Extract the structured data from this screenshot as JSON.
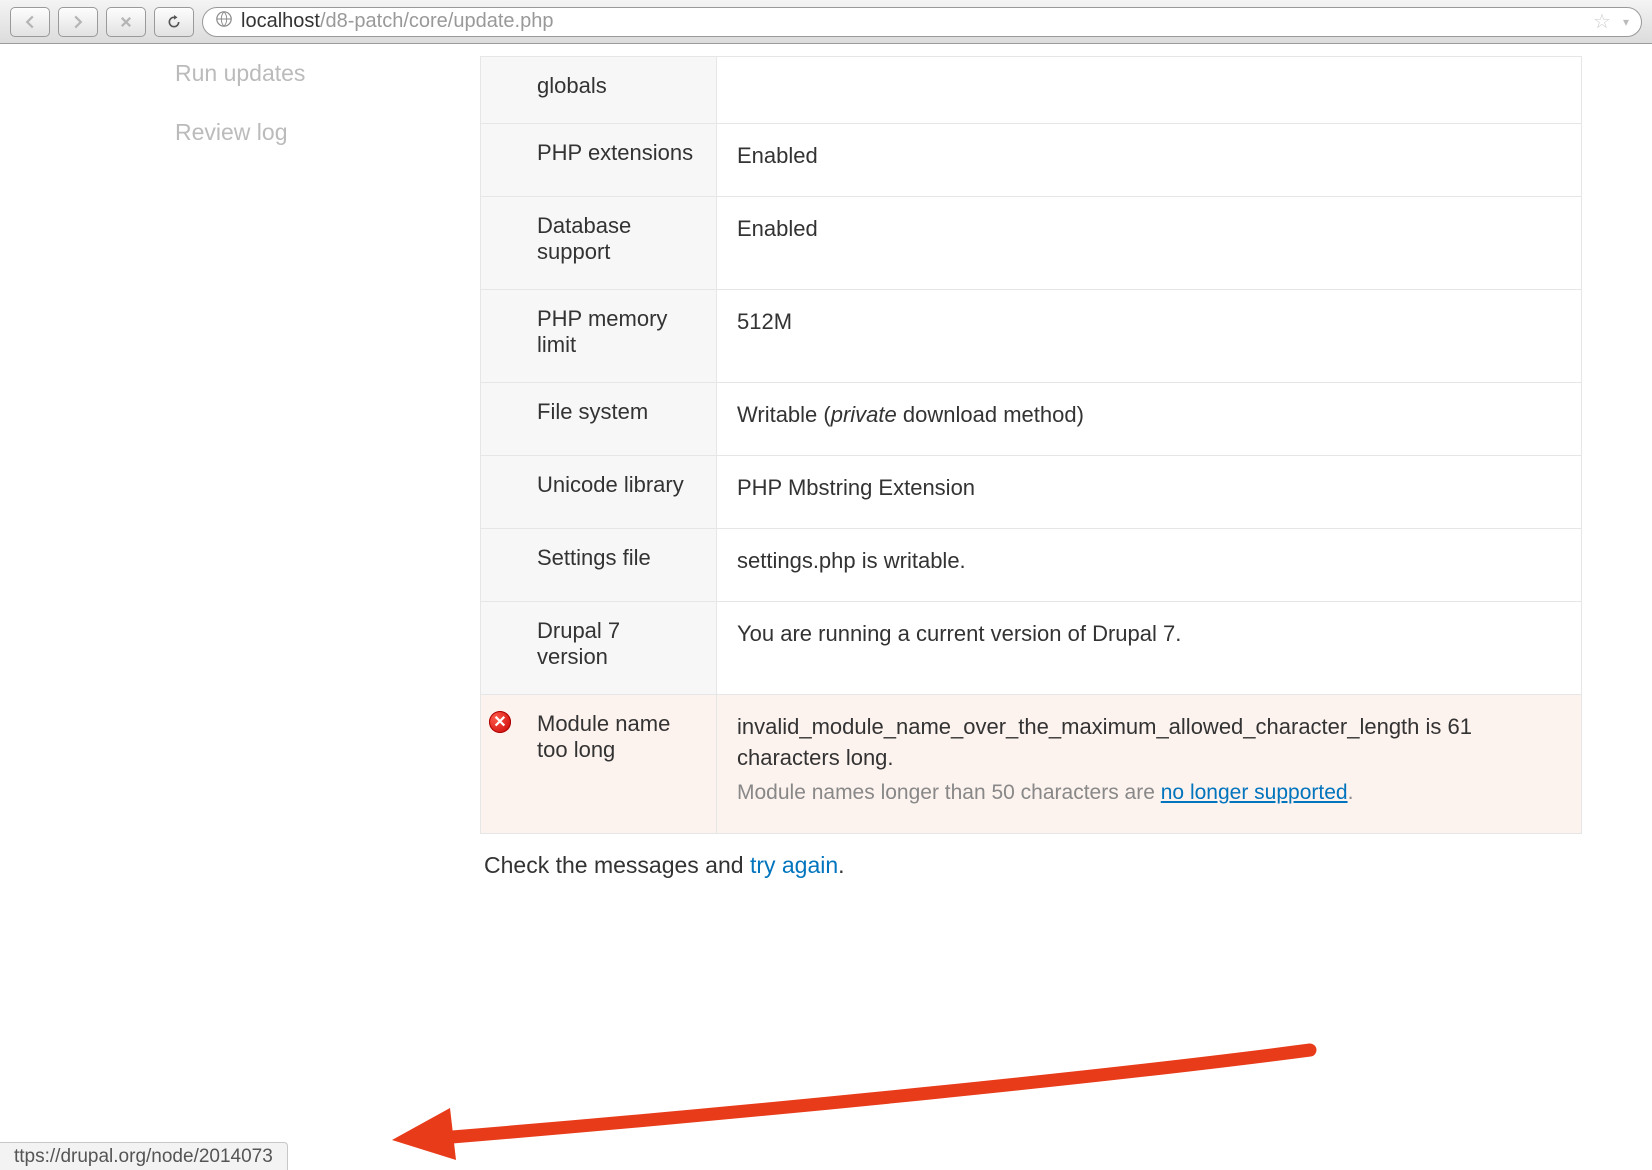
{
  "browser": {
    "url_host": "localhost",
    "url_path": "/d8-patch/core/update.php"
  },
  "sidebar": {
    "items": [
      {
        "label": "Run updates"
      },
      {
        "label": "Review log"
      }
    ]
  },
  "requirements": [
    {
      "label": "globals",
      "value_plain": ""
    },
    {
      "label": "PHP extensions",
      "value_plain": "Enabled"
    },
    {
      "label": "Database support",
      "value_plain": "Enabled"
    },
    {
      "label": "PHP memory limit",
      "value_plain": "512M"
    },
    {
      "label": "File system",
      "value_pre": "Writable (",
      "value_em": "private",
      "value_post": " download method)"
    },
    {
      "label": "Unicode library",
      "value_plain": "PHP Mbstring Extension"
    },
    {
      "label": "Settings file",
      "value_plain": "settings.php is writable."
    },
    {
      "label": "Drupal 7 version",
      "value_plain": "You are running a current version of Drupal 7."
    },
    {
      "label": "Module name too long",
      "error": true,
      "value_plain": "invalid_module_name_over_the_maximum_allowed_character_length is 61 characters long.",
      "sub_pre": "Module names longer than 50 characters are ",
      "sub_link": "no longer supported",
      "sub_post": "."
    }
  ],
  "bottom": {
    "pre": "Check the messages and ",
    "link": "try again",
    "post": "."
  },
  "status_bar": "ttps://drupal.org/node/2014073"
}
